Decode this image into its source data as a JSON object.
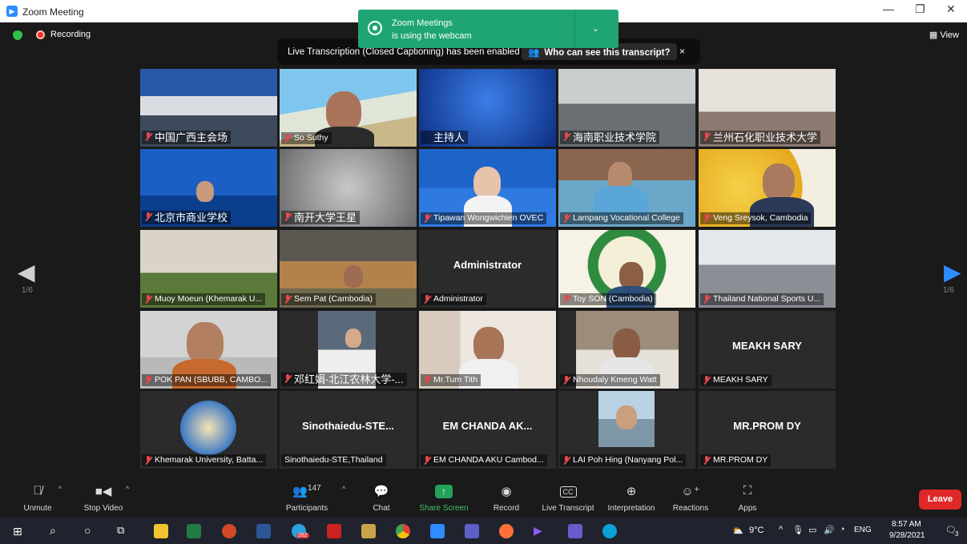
{
  "window": {
    "title": "Zoom Meeting",
    "controls": [
      "minimize-icon",
      "restore-icon",
      "close-icon"
    ]
  },
  "topbar": {
    "recording_label": "Recording",
    "view_label": "View"
  },
  "notification": {
    "line1": "Zoom Meetings",
    "line2": "is using the webcam"
  },
  "transcription_banner": {
    "message": "Live Transcription (Closed Captioning) has been enabled",
    "button": "Who can see this transcript?",
    "close": "×"
  },
  "pagination": {
    "left": "1/6",
    "right": "1/6"
  },
  "tiles": [
    {
      "name": "中国广西主会场",
      "big": true
    },
    {
      "name": "So Suthy",
      "big": false
    },
    {
      "name": "主持人",
      "big": true,
      "active": true
    },
    {
      "name": "海南职业技术学院",
      "big": true
    },
    {
      "name": "兰州石化职业技术大学",
      "big": true
    },
    {
      "name": "北京市商业学校",
      "big": true
    },
    {
      "name": "南开大学王星",
      "big": true
    },
    {
      "name": "Tipawan Wongwichien OVEC",
      "big": false
    },
    {
      "name": "Lampang Vocational College",
      "big": false
    },
    {
      "name": "Veng Sreysok, Cambodia",
      "big": false
    },
    {
      "name": "Muoy Moeun (Khemarak U...",
      "big": false
    },
    {
      "name": "Sem Pat (Cambodia)",
      "big": false
    },
    {
      "name": "Administrator",
      "big": false,
      "center": "Administrator"
    },
    {
      "name": "Toy SON (Cambodia)",
      "big": false
    },
    {
      "name": "Thailand National Sports U...",
      "big": false
    },
    {
      "name": "POK PAN (SBUBB, CAMBO...",
      "big": false
    },
    {
      "name": "邓红娟-北江农林大学-...",
      "big": true
    },
    {
      "name": "Mr.Tum Tith",
      "big": false
    },
    {
      "name": "Nhoudaly Kmeng Watt",
      "big": false
    },
    {
      "name": "MEAKH SARY",
      "big": false,
      "center": "MEAKH SARY"
    },
    {
      "name": "Khemarak University, Batta...",
      "big": false
    },
    {
      "name": "Sinothaiedu-STE,Thailand",
      "big": false,
      "center": "Sinothaiedu-STE...",
      "nomic": true
    },
    {
      "name": "EM CHANDA AKU Cambod...",
      "big": false,
      "center": "EM CHANDA AK..."
    },
    {
      "name": "LAI Poh Hing (Nanyang Pol...",
      "big": false
    },
    {
      "name": "MR.PROM DY",
      "big": false,
      "center": "MR.PROM DY"
    }
  ],
  "toolbar": {
    "unmute": "Unmute",
    "stop_video": "Stop Video",
    "participants": "Participants",
    "participant_count": "147",
    "chat": "Chat",
    "share_screen": "Share Screen",
    "record": "Record",
    "live_transcript": "Live Transcript",
    "interpretation": "Interpretation",
    "reactions": "Reactions",
    "apps": "Apps",
    "leave": "Leave"
  },
  "taskbar": {
    "weather": "9°C",
    "language": "ENG",
    "time": "8:57 AM",
    "date": "9/28/2021",
    "notification_count": "3",
    "chrome_badge": "262"
  },
  "colors": {
    "zoom_blue": "#2d8cff",
    "toast_green": "#1fa574",
    "leave_red": "#e02828",
    "share_green": "#22a25b"
  }
}
